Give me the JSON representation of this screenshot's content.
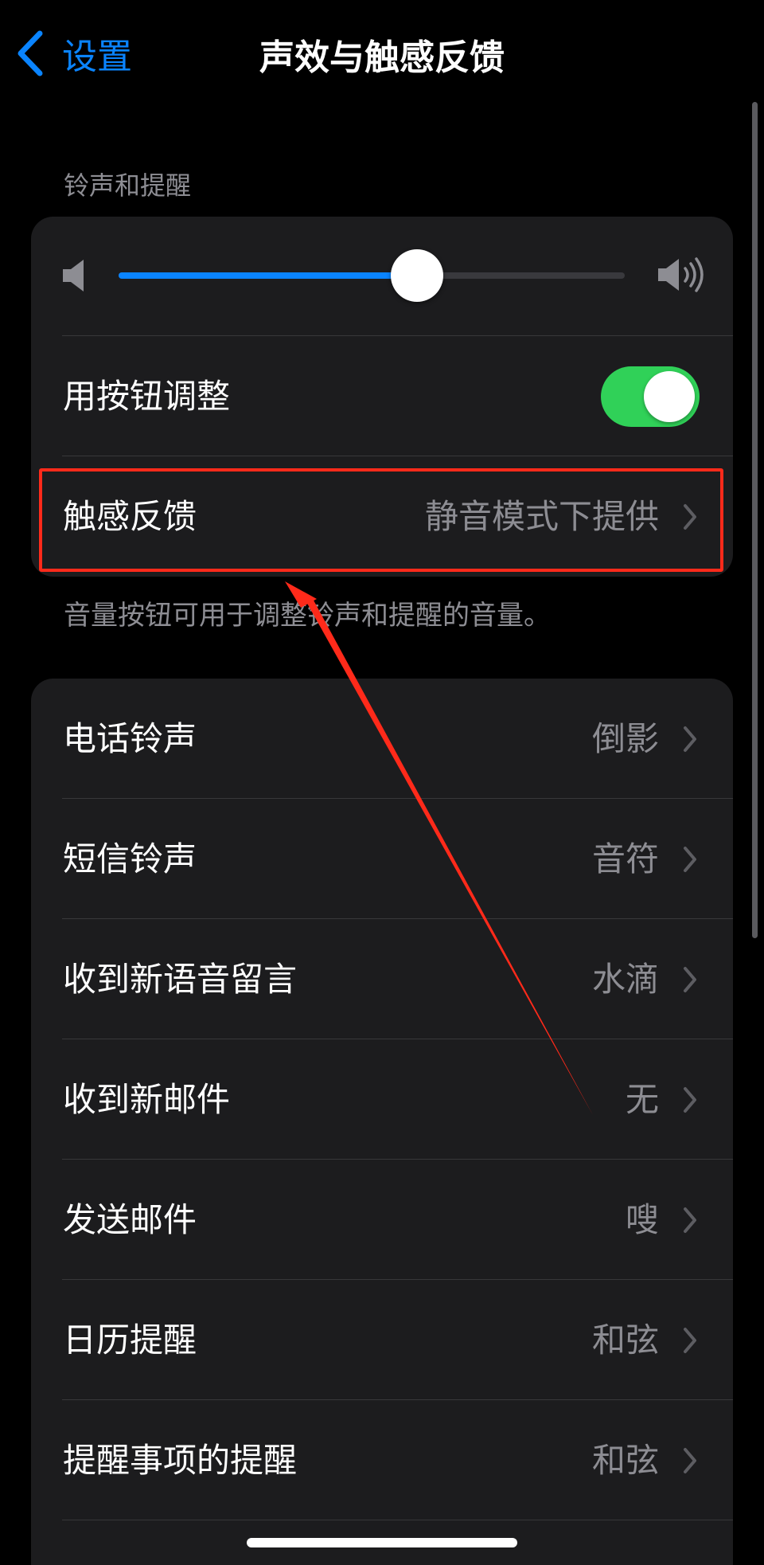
{
  "nav": {
    "back_label": "设置",
    "title": "声效与触感反馈"
  },
  "colors": {
    "accent": "#0a84ff",
    "toggle_on": "#30d158",
    "annotation_red": "#ff2a1a"
  },
  "section1": {
    "header": "铃声和提醒",
    "volume_level": 0.59,
    "toggle_row": {
      "label": "用按钮调整",
      "on": true
    },
    "haptics_row": {
      "label": "触感反馈",
      "value": "静音模式下提供"
    },
    "footer": "音量按钮可用于调整铃声和提醒的音量。"
  },
  "section2": {
    "items": [
      {
        "label": "电话铃声",
        "value": "倒影"
      },
      {
        "label": "短信铃声",
        "value": "音符"
      },
      {
        "label": "收到新语音留言",
        "value": "水滴"
      },
      {
        "label": "收到新邮件",
        "value": "无"
      },
      {
        "label": "发送邮件",
        "value": "嗖"
      },
      {
        "label": "日历提醒",
        "value": "和弦"
      },
      {
        "label": "提醒事项的提醒",
        "value": "和弦"
      }
    ]
  },
  "icons": {
    "back": "chevron-left-icon",
    "volume_low": "speaker-low-icon",
    "volume_high": "speaker-high-icon",
    "disclosure": "chevron-right-icon"
  }
}
